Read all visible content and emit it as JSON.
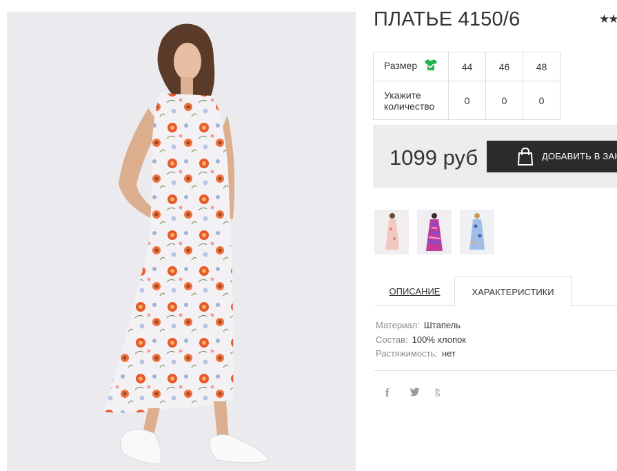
{
  "product": {
    "title": "ПЛАТЬЕ 4150/6",
    "rating_glyphs": "★★"
  },
  "size_table": {
    "size_label": "Размер",
    "quantity_label": "Укажите количество",
    "sizes": [
      "44",
      "46",
      "48"
    ],
    "quantities": [
      "0",
      "0",
      "0"
    ]
  },
  "purchase": {
    "price": "1099 руб",
    "add_to_cart_label": "ДОБАВИТЬ В ЗАКАЗ"
  },
  "thumbnails": [
    {
      "name": "pink-floral-dress"
    },
    {
      "name": "purple-striped-dress"
    },
    {
      "name": "blue-floral-dress"
    }
  ],
  "tabs": {
    "description": "ОПИСАНИЕ",
    "characteristics": "ХАРАКТЕРИСТИКИ",
    "active": "characteristics"
  },
  "specs": [
    {
      "key": "Материал:",
      "value": "Штапель"
    },
    {
      "key": "Состав:",
      "value": "100% хлопок"
    },
    {
      "key": "Растяжимость:",
      "value": "нет"
    }
  ],
  "social": {
    "facebook": "f",
    "twitter": "🐦",
    "google_plus": "g"
  },
  "colors": {
    "accent_green": "#22b14c",
    "button_dark": "#2b2b2b",
    "price_box_bg": "#ededed"
  },
  "icons": [
    "green-tshirt-icon",
    "shopping-bag-icon",
    "facebook-icon",
    "twitter-icon",
    "google-plus-icon",
    "star-icon"
  ]
}
